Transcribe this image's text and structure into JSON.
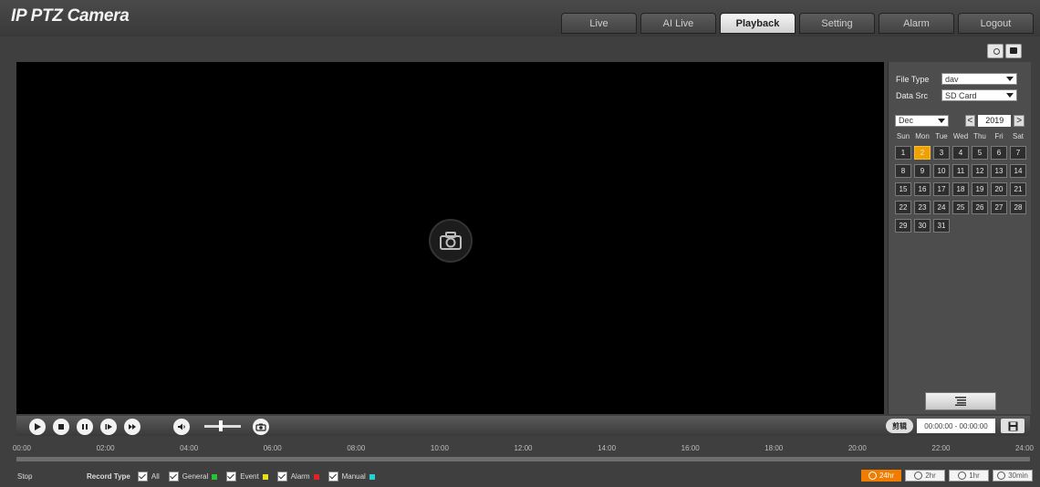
{
  "app": {
    "title": "IP PTZ Camera"
  },
  "nav": {
    "tabs": [
      {
        "label": "Live"
      },
      {
        "label": "AI Live"
      },
      {
        "label": "Playback",
        "active": true
      },
      {
        "label": "Setting"
      },
      {
        "label": "Alarm"
      },
      {
        "label": "Logout"
      }
    ]
  },
  "sidebar": {
    "file_type_label": "File Type",
    "file_type_value": "dav",
    "data_src_label": "Data Src",
    "data_src_value": "SD Card",
    "month": "Dec",
    "year": "2019",
    "prev_label": "<",
    "next_label": ">",
    "weekdays": [
      "Sun",
      "Mon",
      "Tue",
      "Wed",
      "Thu",
      "Fri",
      "Sat"
    ],
    "days": [
      "1",
      "2",
      "3",
      "4",
      "5",
      "6",
      "7",
      "8",
      "9",
      "10",
      "11",
      "12",
      "13",
      "14",
      "15",
      "16",
      "17",
      "18",
      "19",
      "20",
      "21",
      "22",
      "23",
      "24",
      "25",
      "26",
      "27",
      "28",
      "29",
      "30",
      "31"
    ],
    "selected_day": "2"
  },
  "controls": {
    "clip_label": "剪辑",
    "time_range": "00:00:00 - 00:00:00"
  },
  "timeline": {
    "ticks": [
      "00:00",
      "02:00",
      "04:00",
      "06:00",
      "08:00",
      "10:00",
      "12:00",
      "14:00",
      "16:00",
      "18:00",
      "20:00",
      "22:00",
      "24:00"
    ]
  },
  "bottom": {
    "status": "Stop",
    "record_type_label": "Record Type",
    "record_types": [
      {
        "label": "All",
        "color": null
      },
      {
        "label": "General",
        "color": "#2ec12e"
      },
      {
        "label": "Event",
        "color": "#e5e01a"
      },
      {
        "label": "Alarm",
        "color": "#e02424"
      },
      {
        "label": "Manual",
        "color": "#1fd3d3"
      }
    ],
    "zoom_options": [
      {
        "label": "24hr",
        "active": true
      },
      {
        "label": "2hr"
      },
      {
        "label": "1hr"
      },
      {
        "label": "30min"
      }
    ]
  },
  "colors": {
    "accent": "#f07d00",
    "selected_day": "#f0a100"
  },
  "icons": {
    "play": "play-icon",
    "stop": "stop-icon",
    "pause": "pause-icon",
    "slow": "slow-play-icon",
    "fast": "fast-forward-icon",
    "volume": "volume-icon",
    "snapshot": "snapshot-icon",
    "camera": "camera-icon",
    "save": "save-icon",
    "list": "list-icon"
  }
}
